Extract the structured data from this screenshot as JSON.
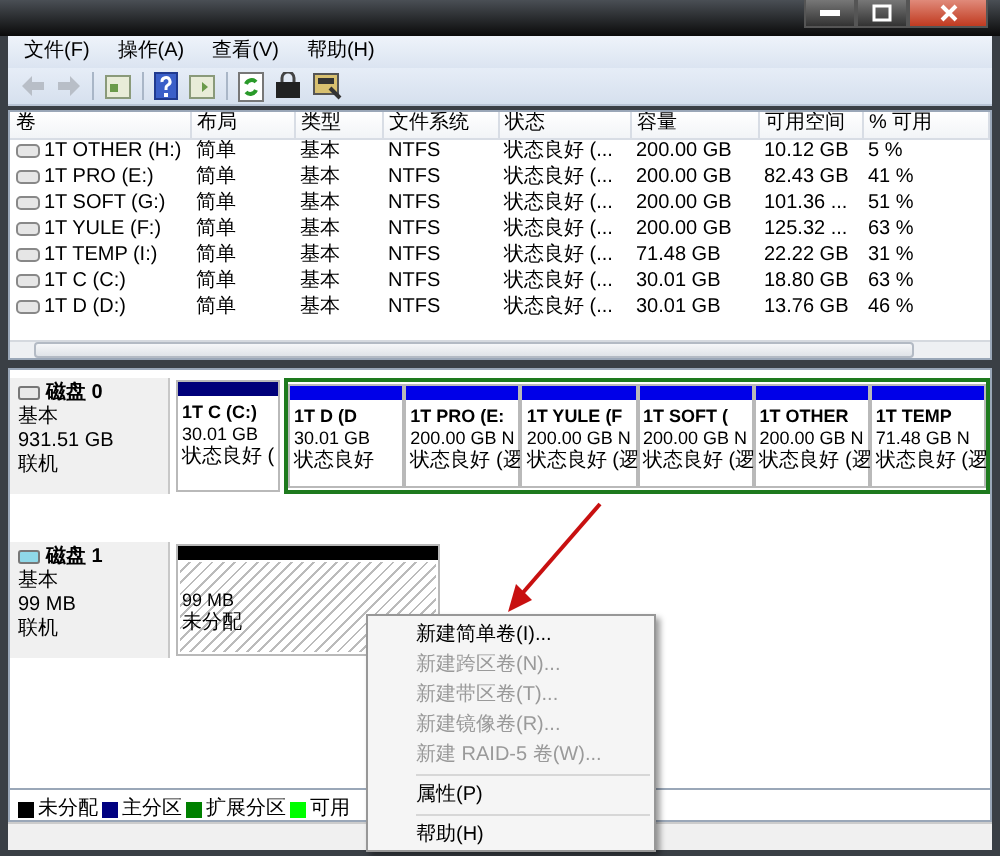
{
  "menu_bar": [
    "文件(F)",
    "操作(A)",
    "查看(V)",
    "帮助(H)"
  ],
  "volume_table": {
    "columns": [
      "卷",
      "布局",
      "类型",
      "文件系统",
      "状态",
      "容量",
      "可用空间",
      "% 可用"
    ],
    "rows": [
      [
        "1T OTHER (H:)",
        "简单",
        "基本",
        "NTFS",
        "状态良好 (...",
        "200.00 GB",
        "10.12 GB",
        "5 %"
      ],
      [
        "1T PRO (E:)",
        "简单",
        "基本",
        "NTFS",
        "状态良好 (...",
        "200.00 GB",
        "82.43 GB",
        "41 %"
      ],
      [
        "1T SOFT (G:)",
        "简单",
        "基本",
        "NTFS",
        "状态良好 (...",
        "200.00 GB",
        "101.36 ...",
        "51 %"
      ],
      [
        "1T YULE (F:)",
        "简单",
        "基本",
        "NTFS",
        "状态良好 (...",
        "200.00 GB",
        "125.32 ...",
        "63 %"
      ],
      [
        "1T TEMP (I:)",
        "简单",
        "基本",
        "NTFS",
        "状态良好 (...",
        "71.48 GB",
        "22.22 GB",
        "31 %"
      ],
      [
        "1T C (C:)",
        "简单",
        "基本",
        "NTFS",
        "状态良好 (...",
        "30.01 GB",
        "18.80 GB",
        "63 %"
      ],
      [
        "1T D (D:)",
        "简单",
        "基本",
        "NTFS",
        "状态良好 (...",
        "30.01 GB",
        "13.76 GB",
        "46 %"
      ]
    ]
  },
  "disks": [
    {
      "name": "磁盘 0",
      "type": "基本",
      "size": "931.51 GB",
      "status": "联机",
      "partitions": [
        {
          "kind": "primary",
          "name": "1T C (C:)",
          "size": "30.01 GB",
          "status": "状态良好 ("
        },
        {
          "kind": "logical",
          "name": "1T D (D",
          "size": "30.01 GB",
          "status": "状态良好"
        },
        {
          "kind": "logical",
          "name": "1T PRO (E:",
          "size": "200.00 GB N",
          "status": "状态良好 (逻"
        },
        {
          "kind": "logical",
          "name": "1T YULE (F",
          "size": "200.00 GB N",
          "status": "状态良好 (逻"
        },
        {
          "kind": "logical",
          "name": "1T SOFT (",
          "size": "200.00 GB N",
          "status": "状态良好 (逻"
        },
        {
          "kind": "logical",
          "name": "1T OTHER",
          "size": "200.00 GB N",
          "status": "状态良好 (逻"
        },
        {
          "kind": "logical",
          "name": "1T TEMP",
          "size": "71.48 GB N",
          "status": "状态良好 (逻"
        }
      ]
    },
    {
      "name": "磁盘 1",
      "type": "基本",
      "size": "99 MB",
      "status": "联机",
      "partitions": [
        {
          "kind": "unallocated",
          "size": "99 MB",
          "status": "未分配"
        }
      ]
    }
  ],
  "legend": [
    {
      "label": "未分配",
      "color": "#000000"
    },
    {
      "label": "主分区",
      "color": "#000080"
    },
    {
      "label": "扩展分区",
      "color": "#008000"
    },
    {
      "label": "可用",
      "color": "#00ff00"
    }
  ],
  "context_menu": [
    {
      "kind": "item",
      "label": "新建简单卷(I)...",
      "disabled": false
    },
    {
      "kind": "item",
      "label": "新建跨区卷(N)...",
      "disabled": true
    },
    {
      "kind": "item",
      "label": "新建带区卷(T)...",
      "disabled": true
    },
    {
      "kind": "item",
      "label": "新建镜像卷(R)...",
      "disabled": true
    },
    {
      "kind": "item",
      "label": "新建 RAID-5 卷(W)...",
      "disabled": true
    },
    {
      "kind": "separator"
    },
    {
      "kind": "item",
      "label": "属性(P)",
      "disabled": false
    },
    {
      "kind": "separator"
    },
    {
      "kind": "item",
      "label": "帮助(H)",
      "disabled": false
    }
  ]
}
